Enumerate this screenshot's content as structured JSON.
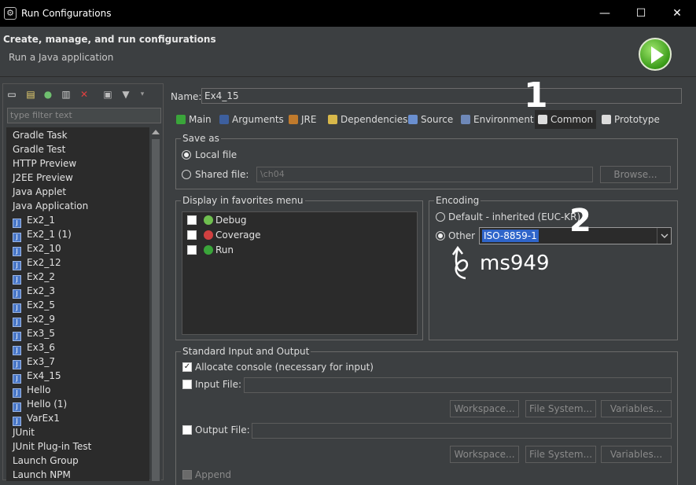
{
  "window": {
    "title": "Run Configurations",
    "minimize_glyph": "—",
    "maximize_glyph": "☐",
    "close_glyph": "✕"
  },
  "header": {
    "title": "Create, manage, and run configurations",
    "subtitle": "Run a Java application"
  },
  "sidebar": {
    "filter_placeholder": "type filter text",
    "items": [
      {
        "label": "Gradle Task",
        "indent": 0,
        "icon": "gradle-icon"
      },
      {
        "label": "Gradle Test",
        "indent": 0,
        "icon": "gradle-icon"
      },
      {
        "label": "HTTP Preview",
        "indent": 0,
        "icon": "http-icon"
      },
      {
        "label": "J2EE Preview",
        "indent": 0,
        "icon": "j2ee-icon"
      },
      {
        "label": "Java Applet",
        "indent": 0,
        "icon": "applet-icon"
      },
      {
        "label": "Java Application",
        "indent": 0,
        "icon": "java-app-icon"
      },
      {
        "label": "Ex2_1",
        "indent": 1,
        "icon": "java-file-icon"
      },
      {
        "label": "Ex2_1 (1)",
        "indent": 1,
        "icon": "java-file-icon"
      },
      {
        "label": "Ex2_10",
        "indent": 1,
        "icon": "java-file-icon"
      },
      {
        "label": "Ex2_12",
        "indent": 1,
        "icon": "java-file-icon"
      },
      {
        "label": "Ex2_2",
        "indent": 1,
        "icon": "java-file-icon"
      },
      {
        "label": "Ex2_3",
        "indent": 1,
        "icon": "java-file-icon"
      },
      {
        "label": "Ex2_5",
        "indent": 1,
        "icon": "java-file-icon"
      },
      {
        "label": "Ex2_9",
        "indent": 1,
        "icon": "java-file-icon"
      },
      {
        "label": "Ex3_5",
        "indent": 1,
        "icon": "java-file-icon"
      },
      {
        "label": "Ex3_6",
        "indent": 1,
        "icon": "java-file-icon"
      },
      {
        "label": "Ex3_7",
        "indent": 1,
        "icon": "java-file-icon"
      },
      {
        "label": "Ex4_15",
        "indent": 1,
        "icon": "java-file-icon"
      },
      {
        "label": "Hello",
        "indent": 1,
        "icon": "java-file-icon"
      },
      {
        "label": "Hello (1)",
        "indent": 1,
        "icon": "java-file-icon"
      },
      {
        "label": "VarEx1",
        "indent": 1,
        "icon": "java-file-icon"
      },
      {
        "label": "JUnit",
        "indent": 0,
        "icon": "junit-icon"
      },
      {
        "label": "JUnit Plug-in Test",
        "indent": 0,
        "icon": "junit-plugin-icon"
      },
      {
        "label": "Launch Group",
        "indent": 0,
        "icon": "launch-group-icon"
      },
      {
        "label": "Launch NPM",
        "indent": 0,
        "icon": "npm-icon"
      }
    ]
  },
  "config": {
    "name_label": "Name:",
    "name_value": "Ex4_15",
    "tabs": [
      {
        "label": "Main",
        "icon": "main-tab-icon",
        "color": "#3aa53a"
      },
      {
        "label": "Arguments",
        "icon": "arguments-tab-icon",
        "color": "#3d5f9e"
      },
      {
        "label": "JRE",
        "icon": "jre-tab-icon",
        "color": "#c07a2c"
      },
      {
        "label": "Dependencies",
        "icon": "dependencies-tab-icon",
        "color": "#d8b84a"
      },
      {
        "label": "Source",
        "icon": "source-tab-icon",
        "color": "#6a8fd0"
      },
      {
        "label": "Environment",
        "icon": "environment-tab-icon",
        "color": "#6e88b8"
      },
      {
        "label": "Common",
        "icon": "common-tab-icon",
        "color": "#dcdcdc"
      },
      {
        "label": "Prototype",
        "icon": "prototype-tab-icon",
        "color": "#dcdcdc"
      }
    ],
    "active_tab": "Common"
  },
  "common": {
    "save_as": {
      "title": "Save as",
      "local_file": "Local file",
      "shared_file": "Shared file:",
      "shared_path": "\\ch04",
      "browse": "Browse...",
      "selected": "local"
    },
    "favorites": {
      "title": "Display in favorites menu",
      "items": [
        {
          "label": "Debug",
          "icon": "debug-icon",
          "checked": false
        },
        {
          "label": "Coverage",
          "icon": "coverage-icon",
          "checked": false
        },
        {
          "label": "Run",
          "icon": "run-icon",
          "checked": false
        }
      ]
    },
    "encoding": {
      "title": "Encoding",
      "default_label": "Default - inherited (EUC-KR)",
      "other_label": "Other",
      "other_value": "ISO-8859-1",
      "selected": "other"
    },
    "std_io": {
      "title": "Standard Input and Output",
      "allocate_console": "Allocate console (necessary for input)",
      "allocate_checked": true,
      "input_file": "Input File:",
      "output_file": "Output File:",
      "workspace": "Workspace...",
      "file_system": "File System...",
      "variables": "Variables...",
      "append": "Append"
    }
  },
  "annotations": {
    "marker_1": "1",
    "marker_2": "2",
    "handwritten_note": "ms949"
  }
}
